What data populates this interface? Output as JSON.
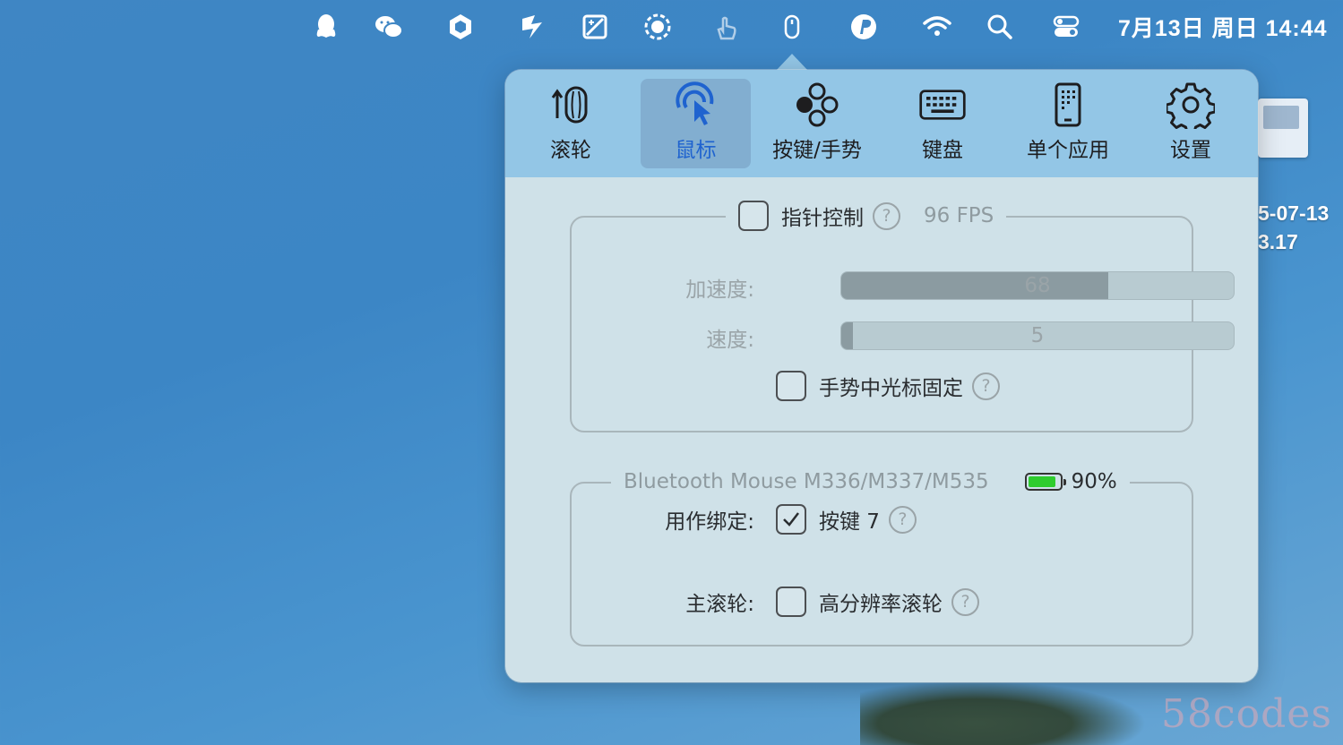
{
  "menubar": {
    "icons": [
      "qq-icon",
      "wechat-icon",
      "hexagon-app-icon",
      "apple-slash-icon",
      "image-edit-icon",
      "record-icon",
      "hand-touch-icon",
      "mouse-icon",
      "paypal-icon",
      "wifi-icon",
      "search-icon",
      "control-center-icon"
    ],
    "clock": "7月13日 周日  14:44"
  },
  "desktop": {
    "file_label_line1": "5-07-13",
    "file_label_line2": "3.17"
  },
  "tabs": [
    {
      "label": "滚轮",
      "icon": "scroll-wheel-icon"
    },
    {
      "label": "鼠标",
      "icon": "cursor-click-icon",
      "active": true
    },
    {
      "label": "按键/手势",
      "icon": "gesture-dots-icon"
    },
    {
      "label": "键盘",
      "icon": "keyboard-icon"
    },
    {
      "label": "单个应用",
      "icon": "phone-app-icon"
    },
    {
      "label": "设置",
      "icon": "gear-icon"
    }
  ],
  "pointer": {
    "title": "指针控制",
    "fps": "96 FPS",
    "enabled": false,
    "accel_label": "加速度:",
    "accel_value": "68",
    "accel_fraction": 0.68,
    "speed_label": "速度:",
    "speed_value": "5",
    "speed_fraction": 0.03,
    "fix_cursor_label": "手势中光标固定",
    "fix_cursor_checked": false
  },
  "device": {
    "name": "Bluetooth Mouse M336/M337/M535",
    "battery": "90%",
    "battery_fraction": 0.9,
    "binding_label": "用作绑定:",
    "binding_value": "按键 7",
    "binding_checked": true,
    "wheel_label": "主滚轮:",
    "wheel_value": "高分辨率滚轮",
    "wheel_checked": false
  },
  "colors": {
    "active_tab_text": "#1f63cf",
    "battery_green": "#2ecc2e",
    "popover_bg": "#cfe1e8",
    "toolbar_bg": "#93c6e6"
  },
  "watermark": "58codes"
}
